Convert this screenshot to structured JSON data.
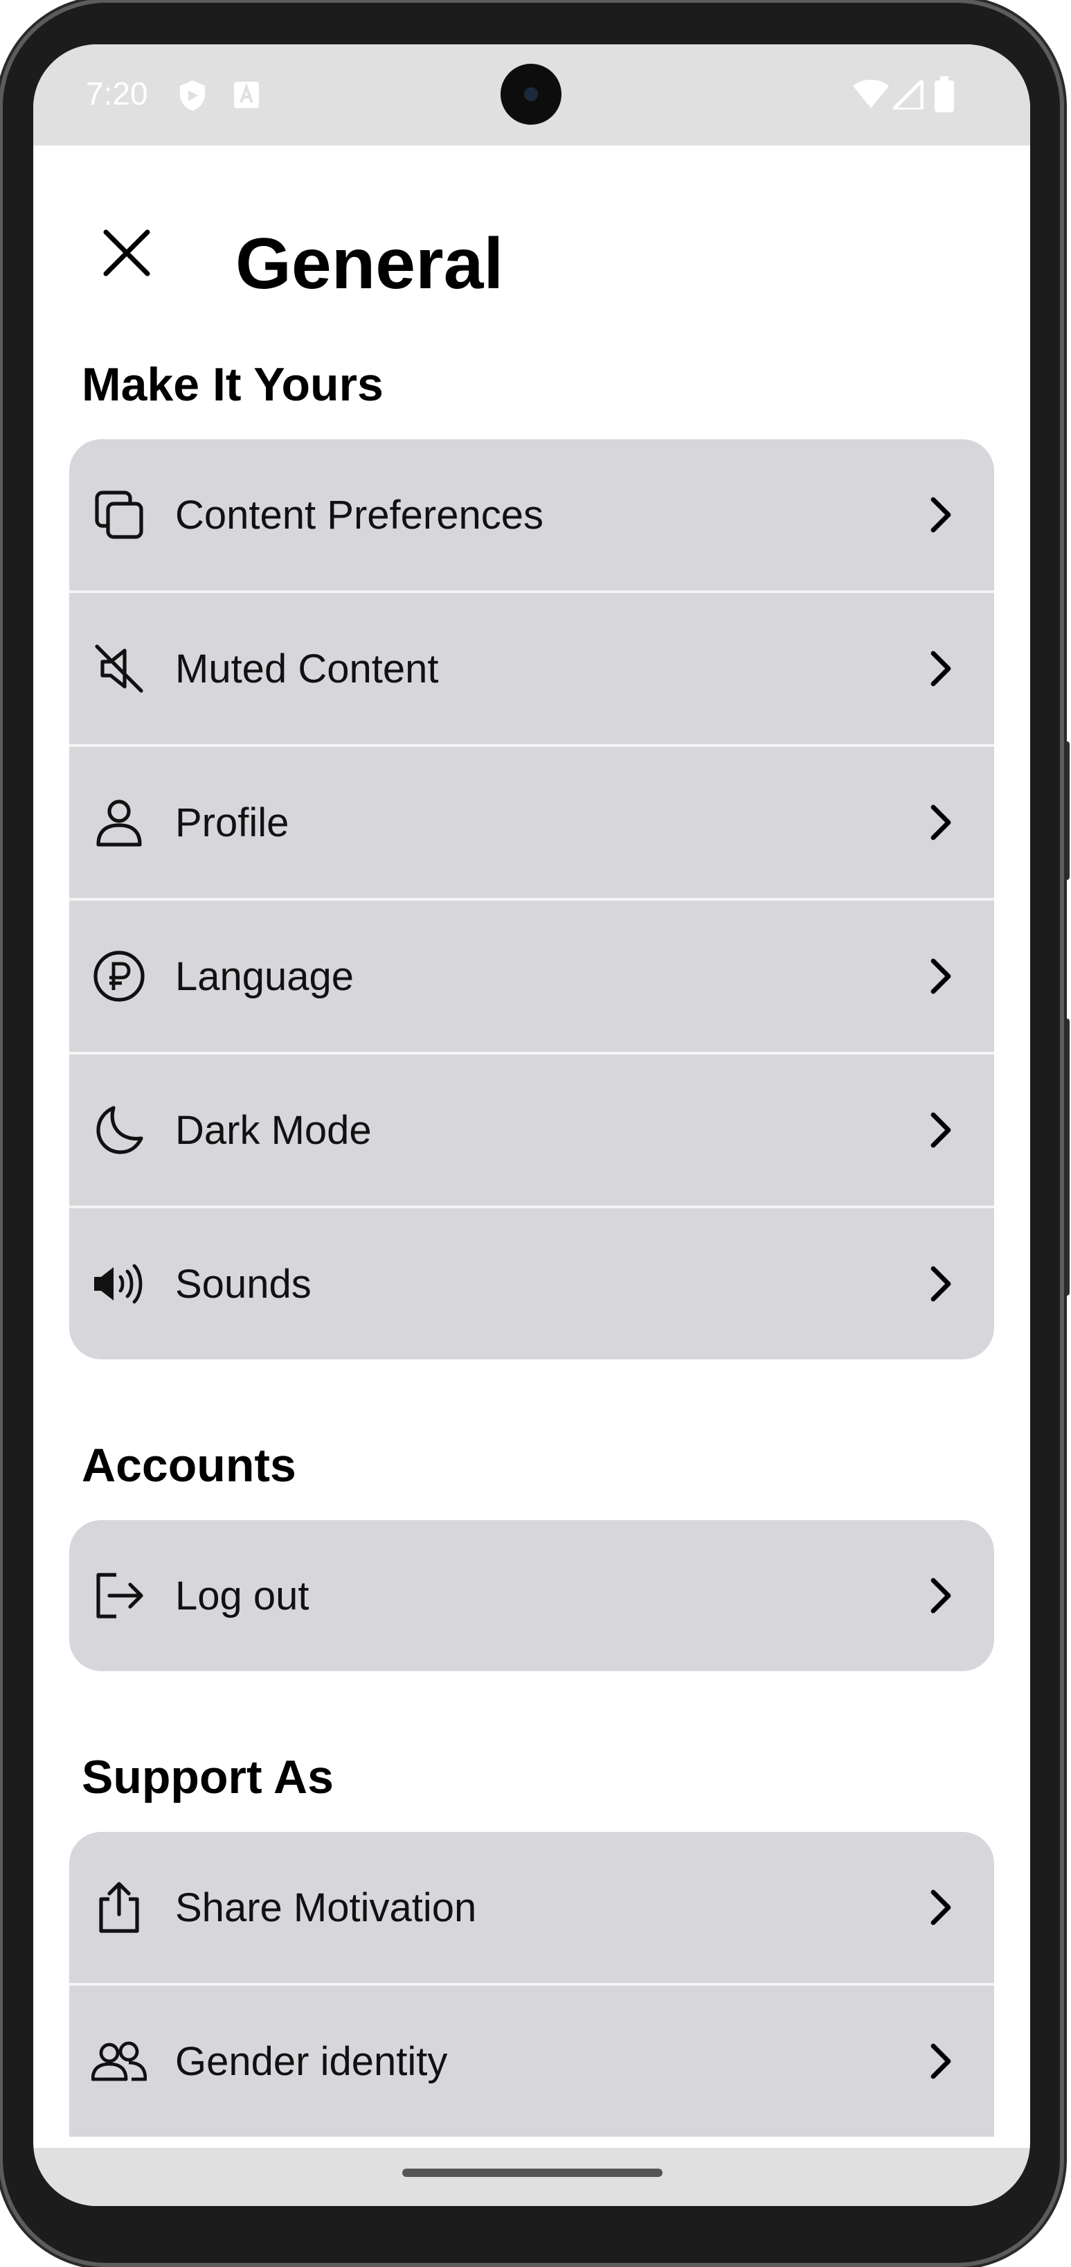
{
  "status_bar": {
    "time": "7:20",
    "left_icons": [
      "shield-icon",
      "font-icon"
    ],
    "right_icons": [
      "wifi-icon",
      "signal-icon",
      "battery-icon"
    ]
  },
  "header": {
    "title": "General",
    "close_icon": "close-icon"
  },
  "sections": [
    {
      "title": "Make It Yours",
      "items": [
        {
          "label": "Content Preferences",
          "icon": "copy-icon"
        },
        {
          "label": "Muted Content",
          "icon": "mute-icon"
        },
        {
          "label": "Profile",
          "icon": "person-icon"
        },
        {
          "label": "Language",
          "icon": "currency-icon"
        },
        {
          "label": "Dark Mode",
          "icon": "moon-icon"
        },
        {
          "label": "Sounds",
          "icon": "speaker-icon"
        }
      ]
    },
    {
      "title": "Accounts",
      "items": [
        {
          "label": "Log out",
          "icon": "logout-icon"
        }
      ]
    },
    {
      "title": "Support As",
      "items": [
        {
          "label": "Share Motivation",
          "icon": "share-icon"
        },
        {
          "label": "Gender identity",
          "icon": "people-icon"
        }
      ]
    }
  ],
  "colors": {
    "row_background": "#d7d7db",
    "status_bar": "#e0e0e0",
    "text": "#111111"
  }
}
